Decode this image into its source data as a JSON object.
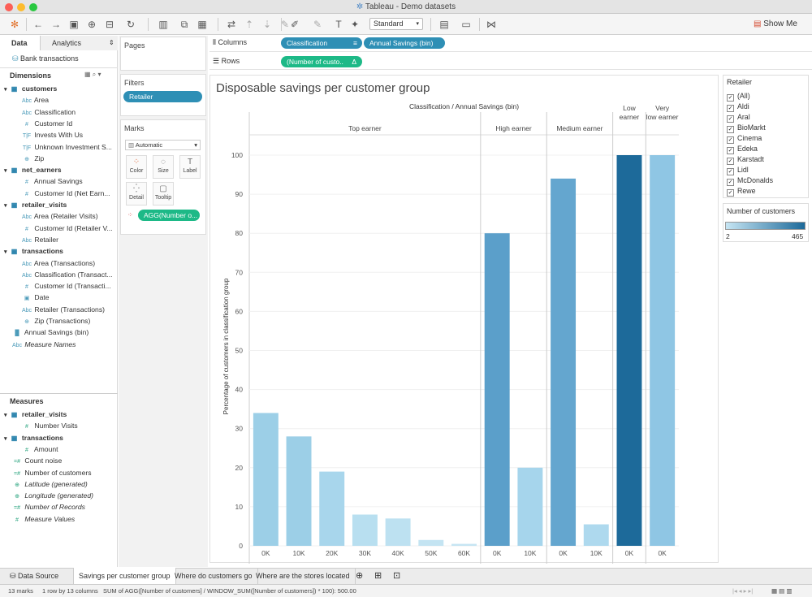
{
  "window": {
    "title": "Tableau - Demo datasets"
  },
  "toolbar": {
    "view_select": "Standard",
    "show_me": "Show Me"
  },
  "left_pane": {
    "tabs": [
      {
        "label": "Data"
      },
      {
        "label": "Analytics"
      }
    ],
    "datasource": "Bank transactions",
    "dimensions_header": "Dimensions",
    "dimensions": [
      {
        "label": "customers",
        "icon": "table-icon",
        "ds": true
      },
      {
        "label": "Area",
        "icon": "Abc"
      },
      {
        "label": "Classification",
        "icon": "Abc"
      },
      {
        "label": "Customer Id",
        "icon": "#"
      },
      {
        "label": "Invests With Us",
        "icon": "T|F"
      },
      {
        "label": "Unknown Investment S...",
        "icon": "T|F"
      },
      {
        "label": "Zip",
        "icon": "globe-icon"
      },
      {
        "label": "net_earners",
        "icon": "table-icon",
        "ds": true
      },
      {
        "label": "Annual Savings",
        "icon": "#"
      },
      {
        "label": "Customer Id (Net Earn...",
        "icon": "#"
      },
      {
        "label": "retailer_visits",
        "icon": "table-icon",
        "ds": true
      },
      {
        "label": "Area (Retailer Visits)",
        "icon": "Abc"
      },
      {
        "label": "Customer Id (Retailer V...",
        "icon": "#"
      },
      {
        "label": "Retailer",
        "icon": "Abc"
      },
      {
        "label": "transactions",
        "icon": "table-icon",
        "ds": true
      },
      {
        "label": "Area (Transactions)",
        "icon": "Abc"
      },
      {
        "label": "Classification (Transact...",
        "icon": "Abc"
      },
      {
        "label": "Customer Id (Transacti...",
        "icon": "#"
      },
      {
        "label": "Date",
        "icon": "calendar-icon"
      },
      {
        "label": "Retailer (Transactions)",
        "icon": "Abc"
      },
      {
        "label": "Zip (Transactions)",
        "icon": "globe-icon"
      },
      {
        "label": "Annual Savings (bin)",
        "icon": "bin-icon",
        "top": true
      },
      {
        "label": "Measure Names",
        "icon": "Abc",
        "top": true,
        "italic": true
      }
    ],
    "measures_header": "Measures",
    "measures": [
      {
        "label": "retailer_visits",
        "icon": "table-icon",
        "ds": true
      },
      {
        "label": "Number Visits",
        "icon": "#"
      },
      {
        "label": "transactions",
        "icon": "table-icon",
        "ds": true
      },
      {
        "label": "Amount",
        "icon": "#"
      },
      {
        "label": "Count noise",
        "icon": "=#",
        "top": true
      },
      {
        "label": "Number of customers",
        "icon": "=#",
        "top": true
      },
      {
        "label": "Latitude (generated)",
        "icon": "globe-icon",
        "top": true,
        "italic": true
      },
      {
        "label": "Longitude (generated)",
        "icon": "globe-icon",
        "top": true,
        "italic": true
      },
      {
        "label": "Number of Records",
        "icon": "=#",
        "top": true,
        "italic": true
      },
      {
        "label": "Measure Values",
        "icon": "#",
        "top": true,
        "italic": true
      }
    ]
  },
  "cards": {
    "pages": "Pages",
    "filters": "Filters",
    "filter_pill": "Retailer",
    "marks": "Marks",
    "mark_type": "Automatic",
    "mark_buttons": [
      "Color",
      "Size",
      "Label",
      "Detail",
      "Tooltip"
    ],
    "marks_pill": "AGG(Number o..."
  },
  "shelves": {
    "columns_label": "Columns",
    "rows_label": "Rows",
    "columns_pills": [
      "Classification",
      "Annual Savings (bin)"
    ],
    "rows_pill": "(Number of custo..",
    "rows_pill_delta": "Δ"
  },
  "chart_data": {
    "type": "bar",
    "title": "Disposable savings per customer group",
    "header": "Classification / Annual Savings (bin)",
    "ylabel": "Percentage of customers in classification group",
    "ylim": [
      0,
      100
    ],
    "yticks": [
      0,
      10,
      20,
      30,
      40,
      50,
      60,
      70,
      80,
      90,
      100
    ],
    "groups": [
      {
        "name": "Top earner",
        "bins": [
          "0K",
          "10K",
          "20K",
          "30K",
          "40K",
          "50K",
          "60K"
        ],
        "values": [
          34,
          28,
          19,
          8,
          7,
          1.5,
          0.5
        ],
        "colors": [
          "#9ccfe7",
          "#9ccfe7",
          "#a8d6ec",
          "#b8dff0",
          "#bde1f1",
          "#c4e4f2",
          "#c6e5f3"
        ]
      },
      {
        "name": "High earner",
        "bins": [
          "0K",
          "10K"
        ],
        "values": [
          80,
          20
        ],
        "colors": [
          "#5b9fca",
          "#a6d5ec"
        ]
      },
      {
        "name": "Medium earner",
        "bins": [
          "0K",
          "10K"
        ],
        "values": [
          94,
          5.5
        ],
        "colors": [
          "#64a6cf",
          "#aed9ee"
        ]
      },
      {
        "name": "Low earner",
        "bins": [
          "0K"
        ],
        "values": [
          100
        ],
        "colors": [
          "#1d6a9a"
        ]
      },
      {
        "name": "Very low earner",
        "bins": [
          "0K"
        ],
        "values": [
          100
        ],
        "colors": [
          "#8fc6e4"
        ]
      }
    ]
  },
  "legend": {
    "title": "Retailer",
    "items": [
      "(All)",
      "Aldi",
      "Aral",
      "BioMarkt",
      "Cinema",
      "Edeka",
      "Karstadt",
      "Lidl",
      "McDonalds",
      "Rewe"
    ],
    "checked": true,
    "color_title": "Number of customers",
    "color_min": "2",
    "color_max": "465",
    "color_low": "#c6e5f3",
    "color_high": "#1d6a9a"
  },
  "bottom_tabs": [
    "Data Source",
    "Savings per customer group",
    "Where do customers go",
    "Where are the stores located"
  ],
  "active_tab": "Savings per customer group",
  "status": {
    "marks": "13 marks",
    "rows": "1 row by 13 columns",
    "calc": "SUM of AGG([Number of customers] / WINDOW_SUM([Number of customers]) * 100): 500.00"
  }
}
